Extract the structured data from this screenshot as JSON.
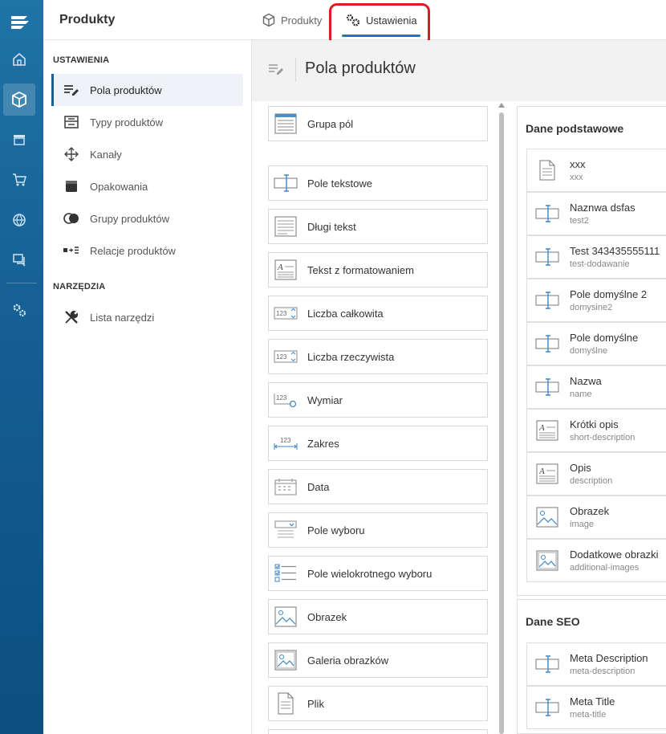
{
  "app": {
    "title": "Produkty"
  },
  "tabs": [
    {
      "label": "Produkty",
      "icon": "cube-icon",
      "active": false
    },
    {
      "label": "Ustawienia",
      "icon": "gears-icon",
      "active": true
    }
  ],
  "sidebar": {
    "sections": [
      {
        "title": "USTAWIENIA",
        "items": [
          {
            "label": "Pola produktów",
            "icon": "fields-edit-icon",
            "active": true
          },
          {
            "label": "Typy produktów",
            "icon": "product-types-icon"
          },
          {
            "label": "Kanały",
            "icon": "channels-icon"
          },
          {
            "label": "Opakowania",
            "icon": "package-icon"
          },
          {
            "label": "Grupy produktów",
            "icon": "groups-icon"
          },
          {
            "label": "Relacje produktów",
            "icon": "relations-icon"
          }
        ]
      },
      {
        "title": "NARZĘDZIA",
        "items": [
          {
            "label": "Lista narzędzi",
            "icon": "tools-icon"
          }
        ]
      }
    ]
  },
  "main": {
    "title": "Pola produktów"
  },
  "palette": [
    {
      "label": "Grupa pól",
      "icon": "field-group-icon"
    },
    {
      "label": "Pole tekstowe",
      "icon": "text-field-icon"
    },
    {
      "label": "Długi tekst",
      "icon": "long-text-icon"
    },
    {
      "label": "Tekst z formatowaniem",
      "icon": "rich-text-icon"
    },
    {
      "label": "Liczba całkowita",
      "icon": "integer-icon"
    },
    {
      "label": "Liczba rzeczywista",
      "icon": "decimal-icon"
    },
    {
      "label": "Wymiar",
      "icon": "dimension-icon"
    },
    {
      "label": "Zakres",
      "icon": "range-icon"
    },
    {
      "label": "Data",
      "icon": "date-icon"
    },
    {
      "label": "Pole wyboru",
      "icon": "select-icon"
    },
    {
      "label": "Pole wielokrotnego wyboru",
      "icon": "multiselect-icon"
    },
    {
      "label": "Obrazek",
      "icon": "image-icon"
    },
    {
      "label": "Galeria obrazków",
      "icon": "gallery-icon"
    },
    {
      "label": "Plik",
      "icon": "file-icon"
    }
  ],
  "groups": [
    {
      "title": "Dane podstawowe",
      "fields": [
        {
          "name": "xxx",
          "code": "xxx",
          "icon": "file-icon"
        },
        {
          "name": "Naznwa dsfas",
          "code": "test2",
          "icon": "text-field-icon"
        },
        {
          "name": "Test 343435555111",
          "code": "test-dodawanie",
          "icon": "text-field-icon"
        },
        {
          "name": "Pole domyślne 2",
          "code": "domysine2",
          "icon": "text-field-icon"
        },
        {
          "name": "Pole domyślne",
          "code": "domyślne",
          "icon": "text-field-icon"
        },
        {
          "name": "Nazwa",
          "code": "name",
          "icon": "text-field-icon"
        },
        {
          "name": "Krótki opis",
          "code": "short-description",
          "icon": "rich-text-icon"
        },
        {
          "name": "Opis",
          "code": "description",
          "icon": "rich-text-icon"
        },
        {
          "name": "Obrazek",
          "code": "image",
          "icon": "image-icon"
        },
        {
          "name": "Dodatkowe obrazki",
          "code": "additional-images",
          "icon": "gallery-icon"
        }
      ]
    },
    {
      "title": "Dane SEO",
      "fields": [
        {
          "name": "Meta Description",
          "code": "meta-description",
          "icon": "text-field-icon"
        },
        {
          "name": "Meta Title",
          "code": "meta-title",
          "icon": "text-field-icon"
        }
      ]
    }
  ],
  "colors": {
    "rail": "#135d92",
    "accent": "#1f73c9",
    "highlight": "#e01a22"
  }
}
